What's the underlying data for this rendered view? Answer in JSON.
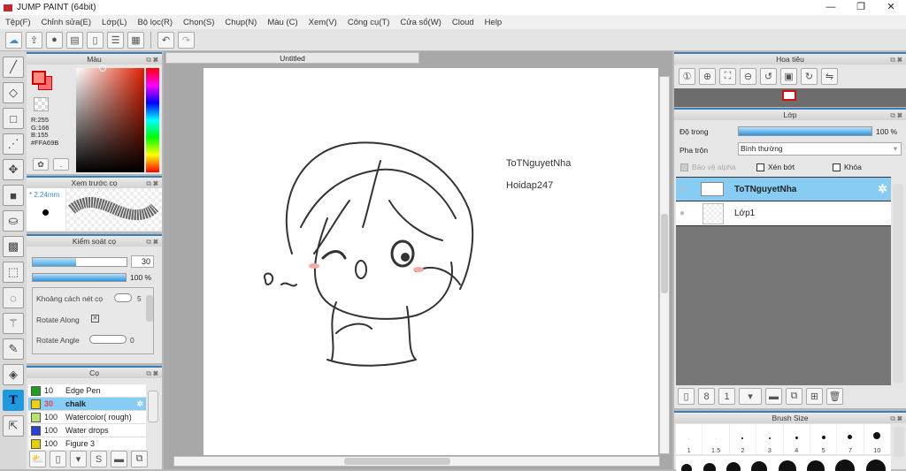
{
  "window": {
    "title": "JUMP PAINT (64bit)",
    "minimize": "—",
    "maximize": "❐",
    "close": "✕"
  },
  "menu": [
    "Tệp(F)",
    "Chỉnh sửa(E)",
    "Lớp(L)",
    "Bộ lọc(R)",
    "Chọn(S)",
    "Chụp(N)",
    "Màu (C)",
    "Xem(V)",
    "Công cụ(T)",
    "Cửa sổ(W)",
    "Cloud",
    "Help"
  ],
  "color_panel": {
    "title": "Màu",
    "r": "R:255",
    "g": "G:166",
    "b": "B:155",
    "hex": "#FFA69B",
    "fg": "#ff8a80",
    "bg": "#ff6e6e"
  },
  "preview_panel": {
    "title": "Xem trước cọ",
    "size": "* 2.24mm"
  },
  "brush_control": {
    "title": "Kiểm soát cọ",
    "size_value": "30",
    "size_fraction": 0.46,
    "opacity_label": "100 %",
    "opacity_fraction": 1.0,
    "spacing_label": "Khoảng cách nét cọ",
    "spacing_value": "5",
    "rotate_along": "Rotate Along",
    "rotate_angle": "Rotate Angle",
    "rotate_angle_value": "0"
  },
  "brushes": {
    "title": "Cọ",
    "items": [
      {
        "size": "10",
        "name": "Edge Pen",
        "color": "#1aa01a"
      },
      {
        "size": "30",
        "name": "chalk",
        "color": "#f0d000",
        "selected": true
      },
      {
        "size": "100",
        "name": "Watercolor( rough)",
        "color": "#b8e070"
      },
      {
        "size": "100",
        "name": "Water drops",
        "color": "#2a40d0"
      },
      {
        "size": "100",
        "name": "Figure 3",
        "color": "#e8d000"
      }
    ]
  },
  "document": {
    "tab": "Untitled",
    "text1": "ToTNguyetNha",
    "text2": "Hoidap247"
  },
  "navigator": {
    "title": "Hoa tiêu"
  },
  "layers": {
    "title": "Lớp",
    "opacity_label": "Độ trong",
    "opacity_value": "100 %",
    "opacity_fraction": 1.0,
    "blend_label": "Pha trộn",
    "blend_value": "Bình thường",
    "protect_alpha": "Bảo vệ alpha",
    "clip": "Xén bớt",
    "lock": "Khóa",
    "items": [
      {
        "name": "ToTNguyetNha",
        "selected": true
      },
      {
        "name": "Lớp1"
      }
    ]
  },
  "brush_size": {
    "title": "Brush Size",
    "sizes": [
      "1",
      "1.5",
      "2",
      "3",
      "4",
      "5",
      "7",
      "10"
    ]
  }
}
